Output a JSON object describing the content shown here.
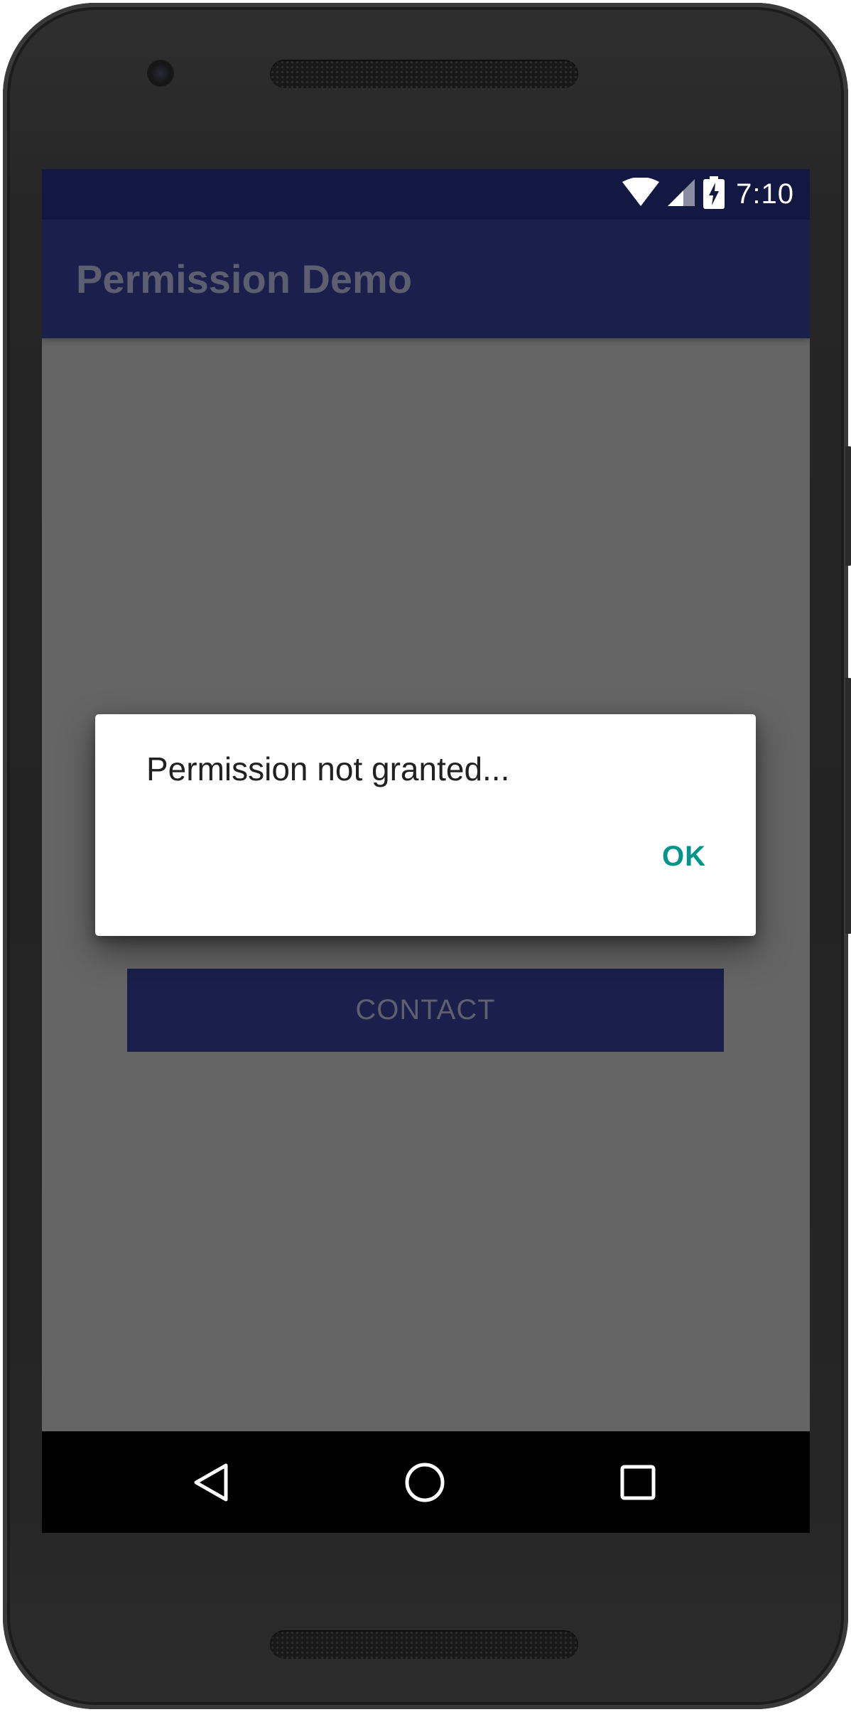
{
  "status_bar": {
    "time": "7:10",
    "icons": [
      "wifi-icon",
      "cell-signal-icon",
      "battery-charging-icon"
    ]
  },
  "app_bar": {
    "title": "Permission Demo"
  },
  "main": {
    "contact_button_label": "CONTACT"
  },
  "dialog": {
    "message": "Permission not granted...",
    "ok_label": "OK"
  },
  "nav_bar": {
    "icons": [
      "back-icon",
      "home-icon",
      "recents-icon"
    ]
  },
  "colors": {
    "status_bar": "#121841",
    "app_bar": "#1a1f4b",
    "scrim_background": "#656565",
    "dialog_accent": "#00958a",
    "nav_bar": "#000000"
  }
}
